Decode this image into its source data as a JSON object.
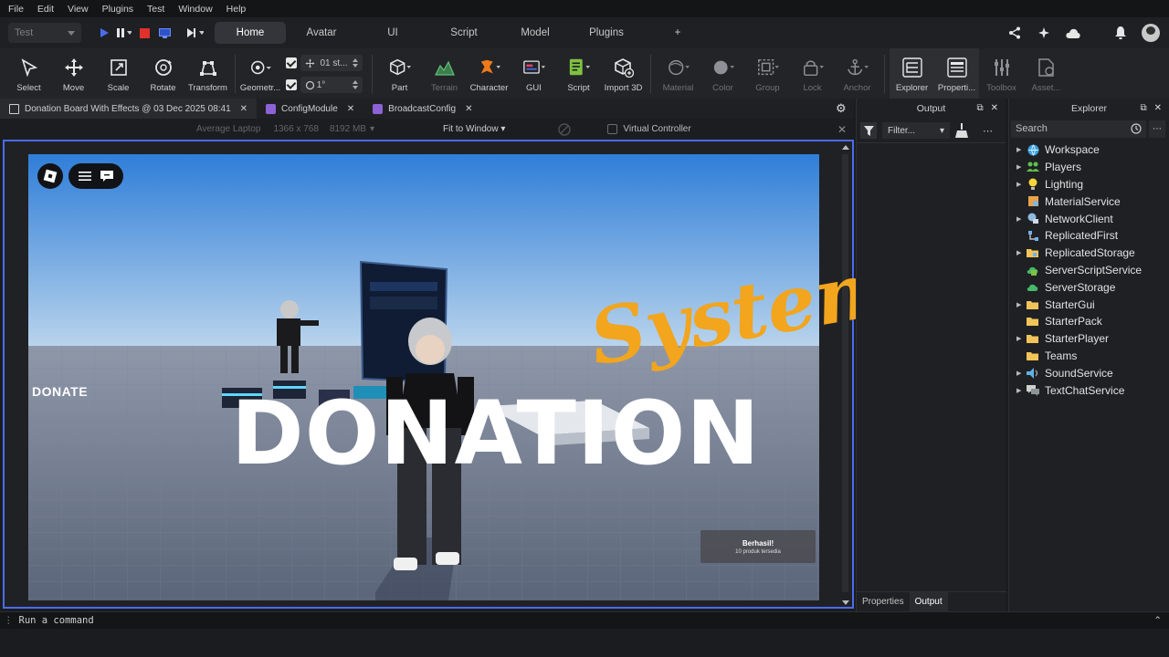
{
  "menu": [
    "File",
    "Edit",
    "View",
    "Plugins",
    "Test",
    "Window",
    "Help"
  ],
  "toolbar": {
    "mode_value": "Test",
    "tabs": [
      "Home",
      "Avatar",
      "UI",
      "Script",
      "Model",
      "Plugins"
    ],
    "active_tab": "Home",
    "add_tab_glyph": "+"
  },
  "ribbon": {
    "tools_a": [
      {
        "label": "Select",
        "icon": "cursor-icon",
        "enabled": true
      },
      {
        "label": "Move",
        "icon": "move-icon",
        "enabled": true
      },
      {
        "label": "Scale",
        "icon": "scale-icon",
        "enabled": true
      },
      {
        "label": "Rotate",
        "icon": "rotate-icon",
        "enabled": true
      },
      {
        "label": "Transform",
        "icon": "transform-icon",
        "enabled": true
      }
    ],
    "geometry_label": "Geometr...",
    "snap_move": "01 st...",
    "snap_rotate": "1°",
    "tools_b": [
      {
        "label": "Part",
        "icon": "cube-icon",
        "enabled": true
      },
      {
        "label": "Terrain",
        "icon": "terrain-icon",
        "enabled": false
      },
      {
        "label": "Character",
        "icon": "character-icon",
        "enabled": true
      },
      {
        "label": "GUI",
        "icon": "gui-icon",
        "enabled": true
      },
      {
        "label": "Script",
        "icon": "script-icon",
        "enabled": true
      },
      {
        "label": "Import 3D",
        "icon": "import-3d-icon",
        "enabled": true
      }
    ],
    "tools_c": [
      {
        "label": "Material",
        "icon": "material-icon",
        "enabled": false
      },
      {
        "label": "Color",
        "icon": "color-icon",
        "enabled": false
      },
      {
        "label": "Group",
        "icon": "group-icon",
        "enabled": false
      },
      {
        "label": "Lock",
        "icon": "lock-icon",
        "enabled": false
      },
      {
        "label": "Anchor",
        "icon": "anchor-icon",
        "enabled": false
      }
    ],
    "tools_d": [
      {
        "label": "Explorer",
        "icon": "explorer-icon",
        "enabled": true
      },
      {
        "label": "Properti...",
        "icon": "properties-icon",
        "enabled": true
      },
      {
        "label": "Toolbox",
        "icon": "toolbox-icon",
        "enabled": false
      },
      {
        "label": "Asset...",
        "icon": "asset-icon",
        "enabled": false
      }
    ]
  },
  "documents": [
    {
      "title": "Donation Board With Effects @ 03 Dec 2025 08:41",
      "icon": "place-file-icon",
      "active": true
    },
    {
      "title": "ConfigModule",
      "icon": "module-script-icon",
      "active": false
    },
    {
      "title": "BroadcastConfig",
      "icon": "module-script-icon",
      "active": false
    }
  ],
  "emulation": {
    "device": "Average Laptop",
    "resolution": "1366 x 768",
    "memory": "8192 MB",
    "fit": "Fit to Window",
    "virtual_controller": "Virtual Controller"
  },
  "viewport": {
    "donate_label": "DONATE",
    "title_main": "DONATION",
    "title_sub": "System",
    "toast_title": "Berhasil!",
    "toast_body": "10 produk tersedia",
    "sky_top": "#2f7ed8",
    "sky_bottom": "#b9d4ec",
    "accent": "#f2a51d"
  },
  "output_panel": {
    "title": "Output",
    "filter_label": "Filter...",
    "bottom_tabs": [
      "Properties",
      "Output"
    ]
  },
  "explorer": {
    "title": "Explorer",
    "search_placeholder": "Search",
    "items": [
      {
        "label": "Workspace",
        "expandable": true,
        "icon": "workspace-icon"
      },
      {
        "label": "Players",
        "expandable": true,
        "icon": "players-icon"
      },
      {
        "label": "Lighting",
        "expandable": true,
        "icon": "lighting-icon"
      },
      {
        "label": "MaterialService",
        "expandable": false,
        "icon": "material-service-icon"
      },
      {
        "label": "NetworkClient",
        "expandable": true,
        "icon": "network-icon"
      },
      {
        "label": "ReplicatedFirst",
        "expandable": false,
        "icon": "replicated-first-icon"
      },
      {
        "label": "ReplicatedStorage",
        "expandable": true,
        "icon": "replicated-storage-icon"
      },
      {
        "label": "ServerScriptService",
        "expandable": false,
        "icon": "server-script-icon"
      },
      {
        "label": "ServerStorage",
        "expandable": false,
        "icon": "server-storage-icon"
      },
      {
        "label": "StarterGui",
        "expandable": true,
        "icon": "starter-gui-icon"
      },
      {
        "label": "StarterPack",
        "expandable": false,
        "icon": "starter-pack-icon"
      },
      {
        "label": "StarterPlayer",
        "expandable": true,
        "icon": "starter-player-icon"
      },
      {
        "label": "Teams",
        "expandable": false,
        "icon": "teams-icon"
      },
      {
        "label": "SoundService",
        "expandable": true,
        "icon": "sound-icon"
      },
      {
        "label": "TextChatService",
        "expandable": true,
        "icon": "text-chat-icon"
      }
    ]
  },
  "command_bar": {
    "placeholder": "Run a command"
  }
}
